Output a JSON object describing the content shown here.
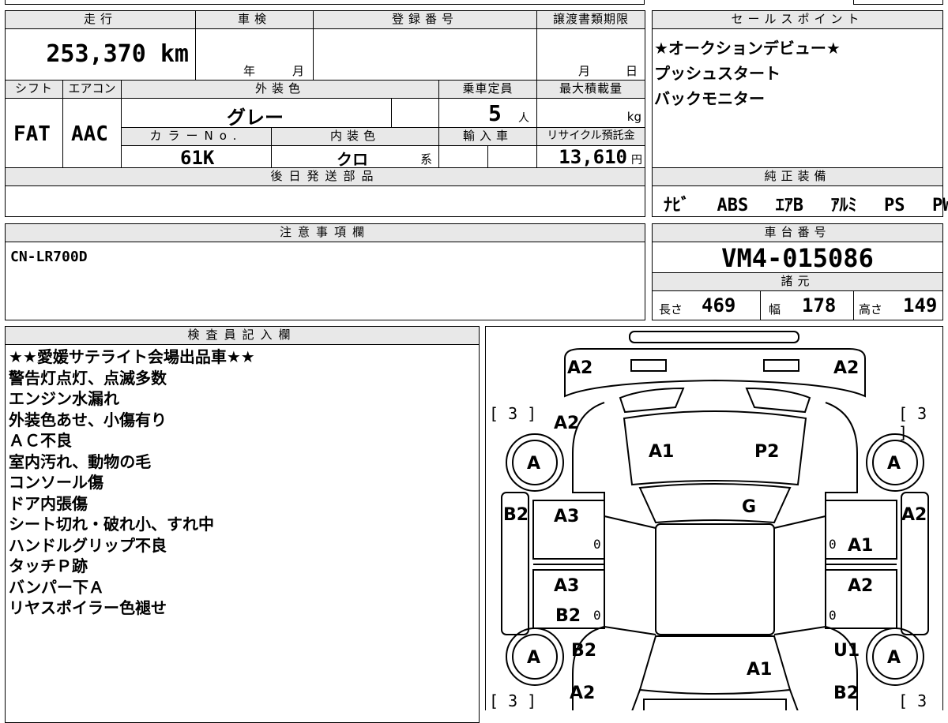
{
  "top": {
    "mileage_header": "走行",
    "inspection_header": "車検",
    "registration_header": "登録番号",
    "transfer_doc_header": "譲渡書類期限",
    "mileage_value": "253,370",
    "mileage_unit": "km",
    "inspection_year_unit": "年",
    "inspection_month_unit": "月",
    "transfer_month_unit": "月",
    "transfer_day_unit": "日",
    "shift_header": "シフト",
    "aircon_header": "エアコン",
    "exterior_color_header": "外装色",
    "capacity_header": "乗車定員",
    "max_load_header": "最大積載量",
    "shift_value": "FAT",
    "aircon_value": "AAC",
    "exterior_color_value": "グレー",
    "capacity_value": "5",
    "capacity_unit": "人",
    "max_load_unit": "kg",
    "color_no_header": "カラーNo.",
    "interior_color_header": "内装色",
    "import_header": "輸入車",
    "recycle_header": "リサイクル預託金",
    "color_no_value": "61K",
    "interior_color_value": "クロ",
    "interior_color_unit": "系",
    "recycle_value": "13,610",
    "recycle_unit": "円",
    "later_parts_header": "後日発送部品"
  },
  "sales": {
    "header": "セールスポイント",
    "lines": [
      "★オークションデビュー★",
      "プッシュスタート",
      "バックモニター"
    ]
  },
  "equipment": {
    "header": "純正装備",
    "items": [
      "ﾅﾋﾞ",
      "ABS",
      "ｴｱB",
      "ｱﾙﾐ",
      "PS",
      "PW"
    ]
  },
  "notes": {
    "header": "注意事項欄",
    "text": "CN-LR700D"
  },
  "chassis": {
    "header": "車台番号",
    "value": "VM4-015086",
    "specs_header": "諸元",
    "length_label": "長さ",
    "length_value": "469",
    "width_label": "幅",
    "width_value": "178",
    "height_label": "高さ",
    "height_value": "149"
  },
  "inspector": {
    "header": "検査員記入欄",
    "lines": [
      "★★愛媛サテライト会場出品車★★",
      "警告灯点灯、点滅多数",
      "エンジン水漏れ",
      "外装色あせ、小傷有り",
      "ＡＣ不良",
      "室内汚れ、動物の毛",
      "コンソール傷",
      "ドア内張傷",
      "シート切れ・破れ小、すれ中",
      "ハンドルグリップ不良",
      "タッチＰ跡",
      "バンパー下Ａ",
      "リヤスポイラー色褪せ"
    ]
  },
  "diagram": {
    "marks": {
      "front_left": "A2",
      "front_right": "A2",
      "bracket_tl": "[ 3 ]",
      "bracket_tr": "[ 3 ]",
      "bracket_bl": "[ 3 ]",
      "bracket_br": "[ 3 ]",
      "fender_fl": "A2",
      "hood_left": "A1",
      "hood_right": "P2",
      "windshield": "G",
      "tire_fl": "A",
      "tire_fr": "A",
      "tire_rl": "A",
      "tire_rr": "A",
      "sill_left": "B2",
      "sill_right": "A2",
      "door_fl": "A3",
      "door_fl_small": "0",
      "door_fr": "A1",
      "door_fr_small": "0",
      "door_rl": "A3",
      "door_rl_b": "B2",
      "door_rl_small": "0",
      "door_rr": "A2",
      "door_rr_small": "0",
      "quarter_rl": "B2",
      "quarter_rr": "U1",
      "trunk": "A1",
      "rear_left": "A2",
      "rear_right": "B2"
    }
  }
}
